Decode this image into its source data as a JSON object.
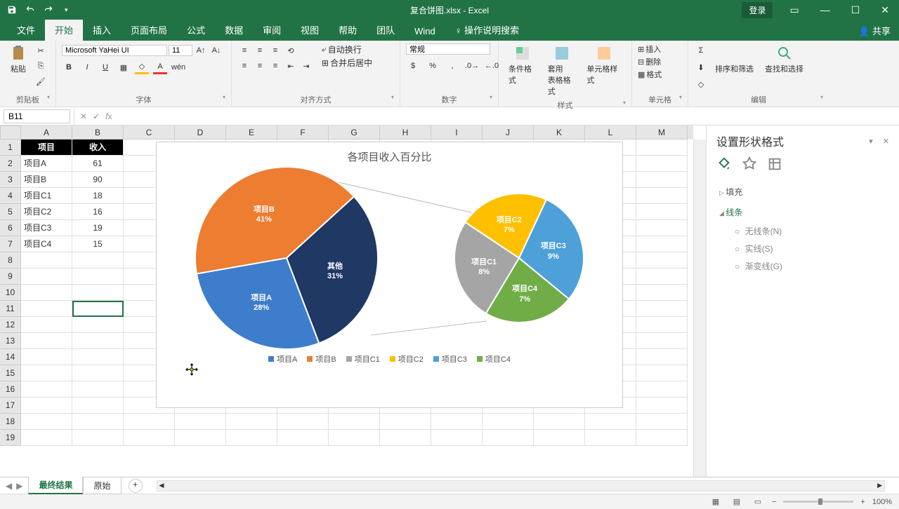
{
  "titlebar": {
    "filename": "复合饼图.xlsx - Excel",
    "login": "登录"
  },
  "tabs": {
    "file": "文件",
    "home": "开始",
    "insert": "插入",
    "layout": "页面布局",
    "formula": "公式",
    "data": "数据",
    "review": "审阅",
    "view": "视图",
    "help": "帮助",
    "team": "团队",
    "wind": "Wind",
    "tellme": "操作说明搜索",
    "share": "共享"
  },
  "ribbon": {
    "clipboard": {
      "paste": "粘贴",
      "label": "剪贴板"
    },
    "font": {
      "name": "Microsoft YaHei UI",
      "size": "11",
      "label": "字体"
    },
    "align": {
      "wrap": "自动换行",
      "merge": "合并后居中",
      "label": "对齐方式"
    },
    "number": {
      "format": "常规",
      "label": "数字"
    },
    "styles": {
      "cond": "条件格式",
      "table": "套用\n表格格式",
      "cell": "单元格样式",
      "label": "样式"
    },
    "cells": {
      "insert": "插入",
      "delete": "删除",
      "format": "格式",
      "label": "单元格"
    },
    "editing": {
      "sort": "排序和筛选",
      "find": "查找和选择",
      "label": "编辑"
    }
  },
  "namebox": "B11",
  "columns": [
    "A",
    "B",
    "C",
    "D",
    "E",
    "F",
    "G",
    "H",
    "I",
    "J",
    "K",
    "L",
    "M"
  ],
  "rows": [
    "1",
    "2",
    "3",
    "4",
    "5",
    "6",
    "7",
    "8",
    "9",
    "10",
    "11",
    "12",
    "13",
    "14",
    "15",
    "16",
    "17",
    "18",
    "19"
  ],
  "table": {
    "header": [
      "项目",
      "收入"
    ],
    "data": [
      [
        "项目A",
        "61"
      ],
      [
        "项目B",
        "90"
      ],
      [
        "项目C1",
        "18"
      ],
      [
        "项目C2",
        "16"
      ],
      [
        "项目C3",
        "19"
      ],
      [
        "项目C4",
        "15"
      ]
    ]
  },
  "chart_data": {
    "type": "pie",
    "title": "各项目收入百分比",
    "main_pie": [
      {
        "name": "项目A",
        "pct": 28,
        "color": "#3E7DCC"
      },
      {
        "name": "项目B",
        "pct": 41,
        "color": "#EC7D31"
      },
      {
        "name": "其他",
        "pct": 31,
        "color": "#1F3864"
      }
    ],
    "sub_pie": [
      {
        "name": "项目C1",
        "pct": 8,
        "color": "#A5A5A5"
      },
      {
        "name": "项目C2",
        "pct": 7,
        "color": "#FFC000"
      },
      {
        "name": "项目C3",
        "pct": 9,
        "color": "#4EA0D9"
      },
      {
        "name": "项目C4",
        "pct": 7,
        "color": "#70AD47"
      }
    ],
    "legend": [
      "项目A",
      "项目B",
      "项目C1",
      "项目C2",
      "项目C3",
      "项目C4"
    ],
    "legend_colors": [
      "#3E7DCC",
      "#EC7D31",
      "#A5A5A5",
      "#FFC000",
      "#4EA0D9",
      "#70AD47"
    ]
  },
  "sidepane": {
    "title": "设置形状格式",
    "sections": {
      "fill": "填充",
      "line": "线条"
    },
    "opts": {
      "noline": "无线条(N)",
      "solid": "实线(S)",
      "gradient": "渐变线(G)"
    }
  },
  "sheets": {
    "s1": "最终结果",
    "s2": "原始"
  },
  "status": {
    "zoom": "100%"
  }
}
